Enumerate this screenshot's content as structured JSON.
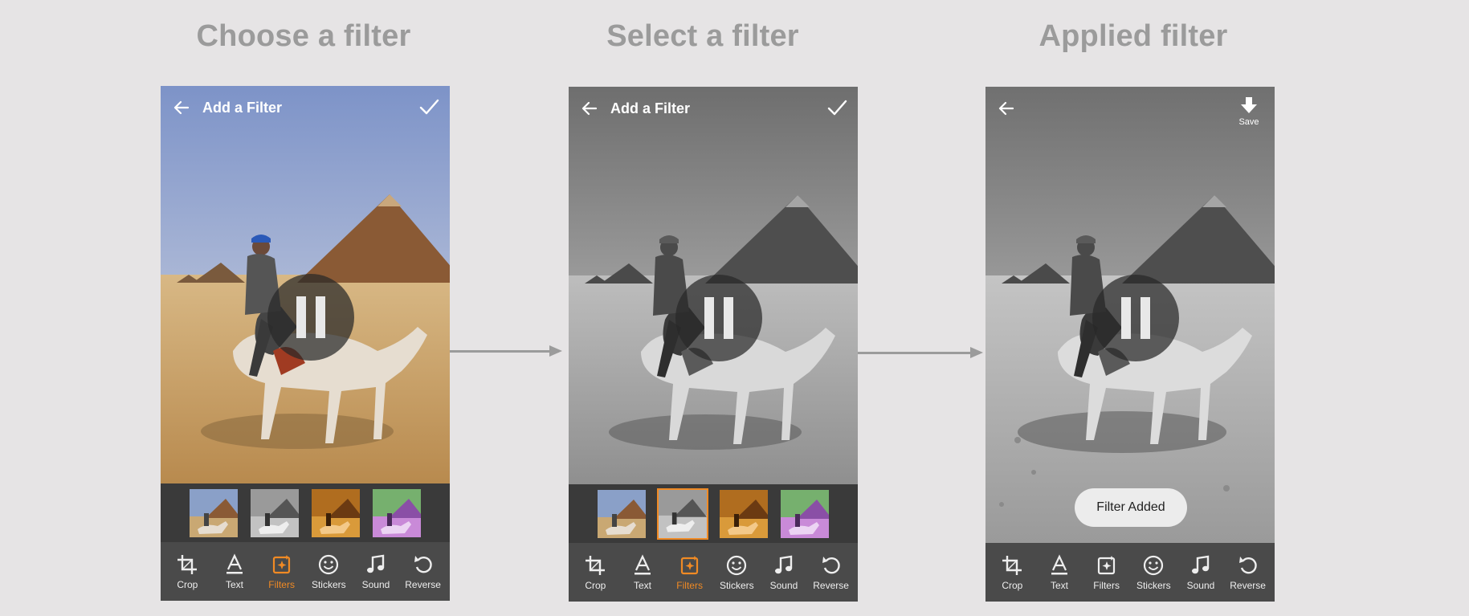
{
  "steps": [
    {
      "title": "Choose a filter"
    },
    {
      "title": "Select a filter"
    },
    {
      "title": "Applied filter"
    }
  ],
  "topbar": {
    "title": "Add a Filter",
    "save_label": "Save"
  },
  "toast": {
    "text": "Filter Added"
  },
  "toolbar": {
    "items": [
      {
        "label": "Crop",
        "icon": "crop-icon"
      },
      {
        "label": "Text",
        "icon": "text-icon"
      },
      {
        "label": "Filters",
        "icon": "filters-icon"
      },
      {
        "label": "Stickers",
        "icon": "stickers-icon"
      },
      {
        "label": "Sound",
        "icon": "sound-icon"
      },
      {
        "label": "Reverse",
        "icon": "reverse-icon"
      }
    ]
  },
  "filters": [
    {
      "name": "original",
      "tint": "#8aa0c8"
    },
    {
      "name": "grayscale",
      "tint": "#9a9a9a"
    },
    {
      "name": "warm",
      "tint": "#c9822c"
    },
    {
      "name": "purple",
      "tint": "#b56ad6"
    }
  ],
  "colors": {
    "accent": "#f08a24",
    "background": "#e6e4e5",
    "title_gray": "#9b9b9b",
    "toolbar": "#4a4a4a",
    "filter_strip": "#3a3a3a"
  }
}
